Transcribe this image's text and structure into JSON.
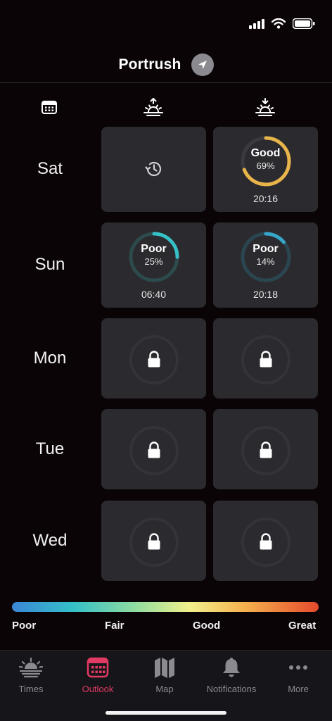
{
  "header": {
    "title": "Portrush"
  },
  "columns": {
    "calendar_icon": "calendar-icon",
    "sunrise_icon": "sunrise-icon",
    "sunset_icon": "sunset-icon"
  },
  "days": [
    {
      "label": "Sat",
      "sunrise": {
        "state": "past",
        "icon": "history-icon"
      },
      "sunset": {
        "state": "forecast",
        "quality": "Good",
        "percent": "69%",
        "value": 0.69,
        "time": "20:16",
        "color": "#e9b44a"
      }
    },
    {
      "label": "Sun",
      "sunrise": {
        "state": "forecast",
        "quality": "Poor",
        "percent": "25%",
        "value": 0.25,
        "time": "06:40",
        "color": "#36c1c6"
      },
      "sunset": {
        "state": "forecast",
        "quality": "Poor",
        "percent": "14%",
        "value": 0.14,
        "time": "20:18",
        "color": "#36a6c9"
      }
    },
    {
      "label": "Mon",
      "sunrise": {
        "state": "locked"
      },
      "sunset": {
        "state": "locked"
      }
    },
    {
      "label": "Tue",
      "sunrise": {
        "state": "locked"
      },
      "sunset": {
        "state": "locked"
      }
    },
    {
      "label": "Wed",
      "sunrise": {
        "state": "locked"
      },
      "sunset": {
        "state": "locked"
      }
    }
  ],
  "scale": {
    "labels": [
      "Poor",
      "Fair",
      "Good",
      "Great"
    ]
  },
  "tabs": [
    {
      "label": "Times",
      "icon": "sunrise-icon",
      "active": false
    },
    {
      "label": "Outlook",
      "icon": "calendar-icon",
      "active": true
    },
    {
      "label": "Map",
      "icon": "map-icon",
      "active": false
    },
    {
      "label": "Notifications",
      "icon": "bell-icon",
      "active": false
    },
    {
      "label": "More",
      "icon": "ellipsis-icon",
      "active": false
    }
  ],
  "colors": {
    "accent": "#e13a63",
    "ring_track": "#3a3a40",
    "cell_bg": "#2b2a2f"
  }
}
